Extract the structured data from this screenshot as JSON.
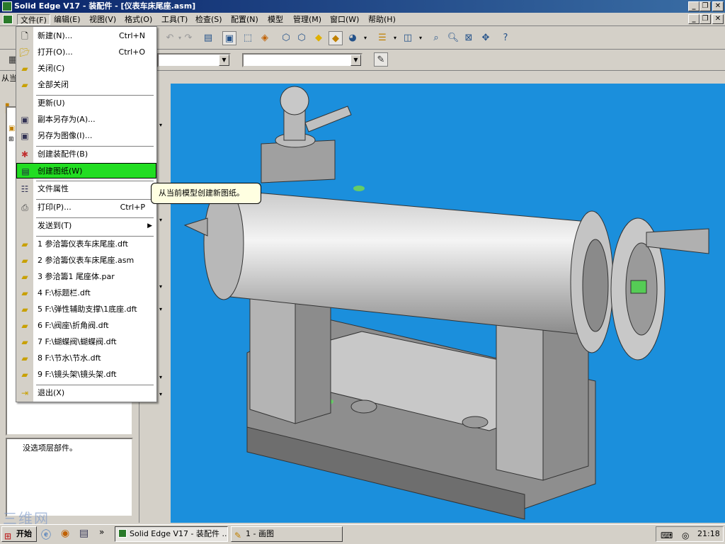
{
  "window": {
    "title": "Solid Edge V17 - 装配件 - [仪表车床尾座.asm]",
    "controls": [
      "_",
      "❐",
      "✕"
    ]
  },
  "menubar": {
    "items": [
      "文件(F)",
      "编辑(E)",
      "视图(V)",
      "格式(O)",
      "工具(T)",
      "检查(S)",
      "配置(N)",
      "模型",
      "管理(M)",
      "窗口(W)",
      "帮助(H)"
    ],
    "active_index": 0
  },
  "left_pane": {
    "label": "从当",
    "status_text": "没选项层部件。"
  },
  "file_menu": {
    "items": [
      {
        "label": "新建(N)...",
        "shortcut": "Ctrl+N",
        "icon": "new-file-icon"
      },
      {
        "label": "打开(O)...",
        "shortcut": "Ctrl+O",
        "icon": "open-folder-icon"
      },
      {
        "label": "关闭(C)",
        "shortcut": "",
        "icon": "close-folder-icon"
      },
      {
        "label": "全部关闭",
        "shortcut": "",
        "icon": "close-all-icon"
      },
      {
        "label": "更新(U)",
        "shortcut": "",
        "icon": ""
      },
      {
        "label": "副本另存为(A)...",
        "shortcut": "",
        "icon": "save-copy-icon"
      },
      {
        "label": "另存为图像(I)...",
        "shortcut": "",
        "icon": "save-image-icon"
      },
      {
        "label": "创建装配件(B)",
        "shortcut": "",
        "icon": "create-assembly-icon"
      },
      {
        "label": "创建图纸(W)",
        "shortcut": "",
        "icon": "create-drawing-icon"
      },
      {
        "label": "文件属性",
        "shortcut": "",
        "icon": "properties-icon"
      },
      {
        "label": "打印(P)...",
        "shortcut": "Ctrl+P",
        "icon": "printer-icon"
      },
      {
        "label": "发送到(T)",
        "shortcut": "",
        "icon": ""
      },
      {
        "label": "1 参洽籌仪表车床尾座.dft",
        "shortcut": "",
        "icon": "recent-file-icon"
      },
      {
        "label": "2 参洽籌仪表车床尾座.asm",
        "shortcut": "",
        "icon": "recent-file-icon"
      },
      {
        "label": "3 参洽籌1 尾座体.par",
        "shortcut": "",
        "icon": "recent-file-icon"
      },
      {
        "label": "4 F:\\标题栏.dft",
        "shortcut": "",
        "icon": "recent-file-icon"
      },
      {
        "label": "5 F:\\弹性辅助支撑\\1底座.dft",
        "shortcut": "",
        "icon": "recent-file-icon"
      },
      {
        "label": "6 F:\\阀座\\折角阀.dft",
        "shortcut": "",
        "icon": "recent-file-icon"
      },
      {
        "label": "7 F:\\蝴蝶阀\\蝴蝶阀.dft",
        "shortcut": "",
        "icon": "recent-file-icon"
      },
      {
        "label": "8 F:\\节水\\节水.dft",
        "shortcut": "",
        "icon": "recent-file-icon"
      },
      {
        "label": "9 F:\\镜头架\\镜头架.dft",
        "shortcut": "",
        "icon": "recent-file-icon"
      },
      {
        "label": "退出(X)",
        "shortcut": "",
        "icon": "exit-icon"
      }
    ],
    "highlighted_index": 8,
    "submenu_arrow": "▶"
  },
  "tooltip": "从当前模型创建新图纸。",
  "taskbar": {
    "start_label": "开始",
    "tasks": [
      "Solid Edge V17 - 装配件 ...",
      "1 - 画图"
    ],
    "more": "»",
    "clock": "21:18"
  },
  "watermark": "三维网",
  "colors": {
    "viewport_bg": "#1b8fdc",
    "highlight": "#22dd22",
    "titlebar": "#0a246a"
  }
}
